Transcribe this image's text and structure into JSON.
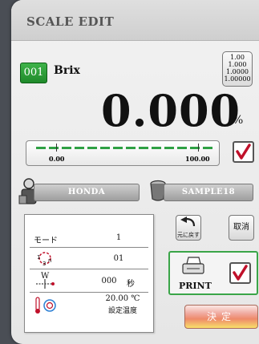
{
  "screen": {
    "title": "SCALE EDIT"
  },
  "material": {
    "code": "001",
    "name": "Brix"
  },
  "decimal_options": [
    "1.00",
    "1.000",
    "1.0000",
    "1.00000"
  ],
  "reading": {
    "value": "0.000",
    "unit": "%"
  },
  "target_bar": {
    "min_label": "0.00",
    "max_label": "100.00",
    "stable_checked": true
  },
  "operator": {
    "name": "HONDA"
  },
  "sample": {
    "name": "SAMPLE18"
  },
  "settings": {
    "mode_label": "モード",
    "mode_value": "1",
    "cycle_value": "01",
    "wait_value": "000",
    "wait_unit": "秒",
    "temp_value": "20.00 ℃",
    "temp_caption": "設定温度"
  },
  "buttons": {
    "undo_label": "元に戻す",
    "cancel_label": "取消",
    "print_label": "PRINT",
    "ok_label": "決定"
  },
  "print_checked": true,
  "colors": {
    "accent_green": "#3aa548",
    "check_red": "#c0102a"
  }
}
